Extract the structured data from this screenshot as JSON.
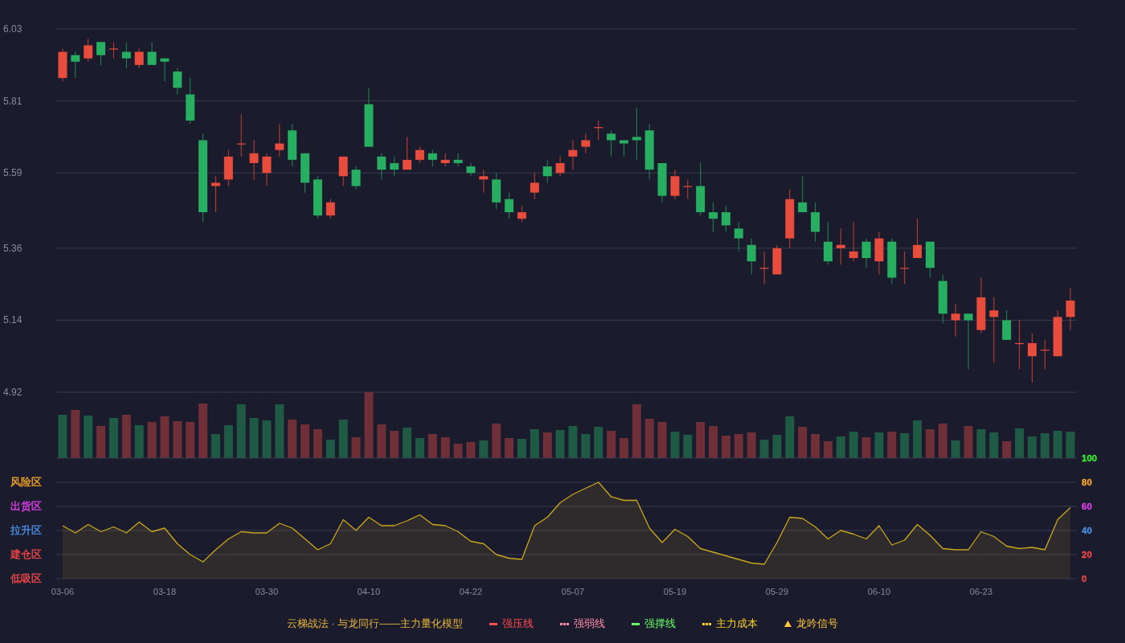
{
  "price_chart": {
    "chart_data": {
      "type": "candlestick",
      "grid": true,
      "ylim": [
        4.92,
        6.03
      ],
      "yticks": [
        4.92,
        5.14,
        5.36,
        5.59,
        5.81,
        6.03
      ],
      "ohlc": [
        [
          5.88,
          5.97,
          5.87,
          5.96
        ],
        [
          5.95,
          5.96,
          5.88,
          5.93
        ],
        [
          5.94,
          6.0,
          5.93,
          5.98
        ],
        [
          5.99,
          5.99,
          5.92,
          5.95
        ],
        [
          5.97,
          5.99,
          5.94,
          5.97
        ],
        [
          5.96,
          5.99,
          5.91,
          5.94
        ],
        [
          5.92,
          5.97,
          5.91,
          5.96
        ],
        [
          5.96,
          5.99,
          5.92,
          5.92
        ],
        [
          5.94,
          5.94,
          5.87,
          5.93
        ],
        [
          5.9,
          5.91,
          5.83,
          5.85
        ],
        [
          5.83,
          5.88,
          5.74,
          5.75
        ],
        [
          5.69,
          5.71,
          5.44,
          5.47
        ],
        [
          5.55,
          5.58,
          5.47,
          5.56
        ],
        [
          5.57,
          5.66,
          5.55,
          5.64
        ],
        [
          5.68,
          5.77,
          5.64,
          5.68
        ],
        [
          5.62,
          5.69,
          5.57,
          5.65
        ],
        [
          5.59,
          5.65,
          5.55,
          5.64
        ],
        [
          5.66,
          5.74,
          5.64,
          5.68
        ],
        [
          5.72,
          5.74,
          5.61,
          5.63
        ],
        [
          5.65,
          5.65,
          5.53,
          5.56
        ],
        [
          5.57,
          5.58,
          5.45,
          5.46
        ],
        [
          5.46,
          5.51,
          5.45,
          5.5
        ],
        [
          5.58,
          5.64,
          5.55,
          5.64
        ],
        [
          5.6,
          5.61,
          5.54,
          5.55
        ],
        [
          5.8,
          5.85,
          5.67,
          5.67
        ],
        [
          5.64,
          5.65,
          5.57,
          5.6
        ],
        [
          5.62,
          5.64,
          5.58,
          5.6
        ],
        [
          5.6,
          5.7,
          5.6,
          5.63
        ],
        [
          5.63,
          5.67,
          5.62,
          5.66
        ],
        [
          5.65,
          5.66,
          5.61,
          5.63
        ],
        [
          5.62,
          5.65,
          5.61,
          5.63
        ],
        [
          5.63,
          5.65,
          5.61,
          5.62
        ],
        [
          5.61,
          5.62,
          5.58,
          5.59
        ],
        [
          5.57,
          5.6,
          5.53,
          5.58
        ],
        [
          5.57,
          5.59,
          5.48,
          5.5
        ],
        [
          5.51,
          5.53,
          5.45,
          5.47
        ],
        [
          5.45,
          5.49,
          5.44,
          5.47
        ],
        [
          5.53,
          5.59,
          5.51,
          5.56
        ],
        [
          5.61,
          5.63,
          5.56,
          5.58
        ],
        [
          5.59,
          5.64,
          5.58,
          5.62
        ],
        [
          5.64,
          5.69,
          5.6,
          5.66
        ],
        [
          5.67,
          5.71,
          5.65,
          5.69
        ],
        [
          5.73,
          5.75,
          5.69,
          5.73
        ],
        [
          5.71,
          5.72,
          5.64,
          5.69
        ],
        [
          5.69,
          5.69,
          5.64,
          5.68
        ],
        [
          5.7,
          5.79,
          5.63,
          5.69
        ],
        [
          5.72,
          5.74,
          5.57,
          5.6
        ],
        [
          5.62,
          5.62,
          5.5,
          5.52
        ],
        [
          5.52,
          5.6,
          5.51,
          5.58
        ],
        [
          5.55,
          5.57,
          5.51,
          5.55
        ],
        [
          5.55,
          5.62,
          5.46,
          5.47
        ],
        [
          5.47,
          5.5,
          5.41,
          5.45
        ],
        [
          5.47,
          5.49,
          5.41,
          5.43
        ],
        [
          5.42,
          5.44,
          5.35,
          5.39
        ],
        [
          5.37,
          5.39,
          5.28,
          5.32
        ],
        [
          5.3,
          5.35,
          5.25,
          5.3
        ],
        [
          5.28,
          5.37,
          5.28,
          5.36
        ],
        [
          5.39,
          5.54,
          5.36,
          5.51
        ],
        [
          5.5,
          5.58,
          5.47,
          5.47
        ],
        [
          5.47,
          5.5,
          5.38,
          5.41
        ],
        [
          5.38,
          5.44,
          5.31,
          5.32
        ],
        [
          5.36,
          5.42,
          5.31,
          5.37
        ],
        [
          5.33,
          5.44,
          5.32,
          5.35
        ],
        [
          5.38,
          5.39,
          5.3,
          5.33
        ],
        [
          5.32,
          5.41,
          5.28,
          5.39
        ],
        [
          5.38,
          5.39,
          5.25,
          5.27
        ],
        [
          5.3,
          5.35,
          5.25,
          5.3
        ],
        [
          5.33,
          5.45,
          5.33,
          5.37
        ],
        [
          5.38,
          5.38,
          5.27,
          5.3
        ],
        [
          5.26,
          5.28,
          5.13,
          5.16
        ],
        [
          5.14,
          5.19,
          5.09,
          5.16
        ],
        [
          5.16,
          5.16,
          4.99,
          5.14
        ],
        [
          5.11,
          5.27,
          5.1,
          5.21
        ],
        [
          5.15,
          5.21,
          5.01,
          5.17
        ],
        [
          5.14,
          5.17,
          5.08,
          5.08
        ],
        [
          5.07,
          5.14,
          4.99,
          5.07
        ],
        [
          5.03,
          5.1,
          4.95,
          5.07
        ],
        [
          5.05,
          5.08,
          4.99,
          5.05
        ],
        [
          5.03,
          5.17,
          5.03,
          5.15
        ],
        [
          5.15,
          5.24,
          5.11,
          5.2
        ]
      ]
    }
  },
  "indicator": {
    "zones": [
      {
        "label": "风险区",
        "color": "#f5a623"
      },
      {
        "label": "出货区",
        "color": "#e040e8"
      },
      {
        "label": "拉升区",
        "color": "#4a8fe2"
      },
      {
        "label": "建仓区",
        "color": "#f04848"
      },
      {
        "label": "低吸区",
        "color": "#f04848"
      }
    ],
    "ytick_marks": [
      {
        "color": "#f04848"
      },
      {
        "color": "#f04848"
      },
      {
        "color": "#4a8fe2"
      },
      {
        "color": "#e040e8"
      },
      {
        "color": "#f5a623"
      },
      {
        "color": "#33ee33"
      }
    ],
    "chart_data": {
      "type": "area",
      "grid": true,
      "ylim": [
        0,
        100
      ],
      "yticks": [
        0,
        20,
        40,
        60,
        80,
        100
      ],
      "categories": [
        "03-06",
        null,
        null,
        null,
        null,
        null,
        null,
        null,
        "03-18",
        null,
        null,
        null,
        null,
        null,
        null,
        null,
        "03-30",
        null,
        null,
        null,
        null,
        null,
        null,
        null,
        "04-10",
        null,
        null,
        null,
        null,
        null,
        null,
        null,
        "04-22",
        null,
        null,
        null,
        null,
        null,
        null,
        null,
        "05-07",
        null,
        null,
        null,
        null,
        null,
        null,
        null,
        "05-19",
        null,
        null,
        null,
        null,
        null,
        null,
        null,
        "05-29",
        null,
        null,
        null,
        null,
        null,
        null,
        null,
        "06-10",
        null,
        null,
        null,
        null,
        null,
        null,
        null,
        "06-23",
        null,
        null,
        null,
        null,
        null,
        null,
        null
      ],
      "values": [
        44,
        38,
        45,
        39,
        43,
        38,
        47,
        39,
        42,
        29,
        20,
        14,
        24,
        33,
        39,
        38,
        38,
        46,
        42,
        33,
        24,
        29,
        49,
        40,
        51,
        44,
        44,
        48,
        53,
        45,
        44,
        39,
        31,
        29,
        20,
        17,
        16,
        44,
        51,
        63,
        70,
        75,
        80,
        68,
        65,
        65,
        42,
        30,
        41,
        35,
        25,
        22,
        19,
        16,
        13,
        12,
        30,
        51,
        50,
        43,
        33,
        40,
        37,
        33,
        44,
        28,
        32,
        45,
        36,
        25,
        24,
        24,
        39,
        35,
        27,
        25,
        26,
        24,
        49,
        59
      ]
    }
  },
  "legend": {
    "title": "云梯战法 · 与龙同行——主力量化模型",
    "items": [
      {
        "label": "强压线",
        "kind": "solid",
        "color": "#ff4d4d"
      },
      {
        "label": "强弱线",
        "kind": "dashed",
        "color": "#ff8fa3"
      },
      {
        "label": "强撑线",
        "kind": "solid",
        "color": "#66ff66"
      },
      {
        "label": "主力成本",
        "kind": "dashed",
        "color": "#ffd21f"
      },
      {
        "label": "龙吟信号",
        "kind": "triangle",
        "color": "#ffc53d"
      }
    ]
  }
}
